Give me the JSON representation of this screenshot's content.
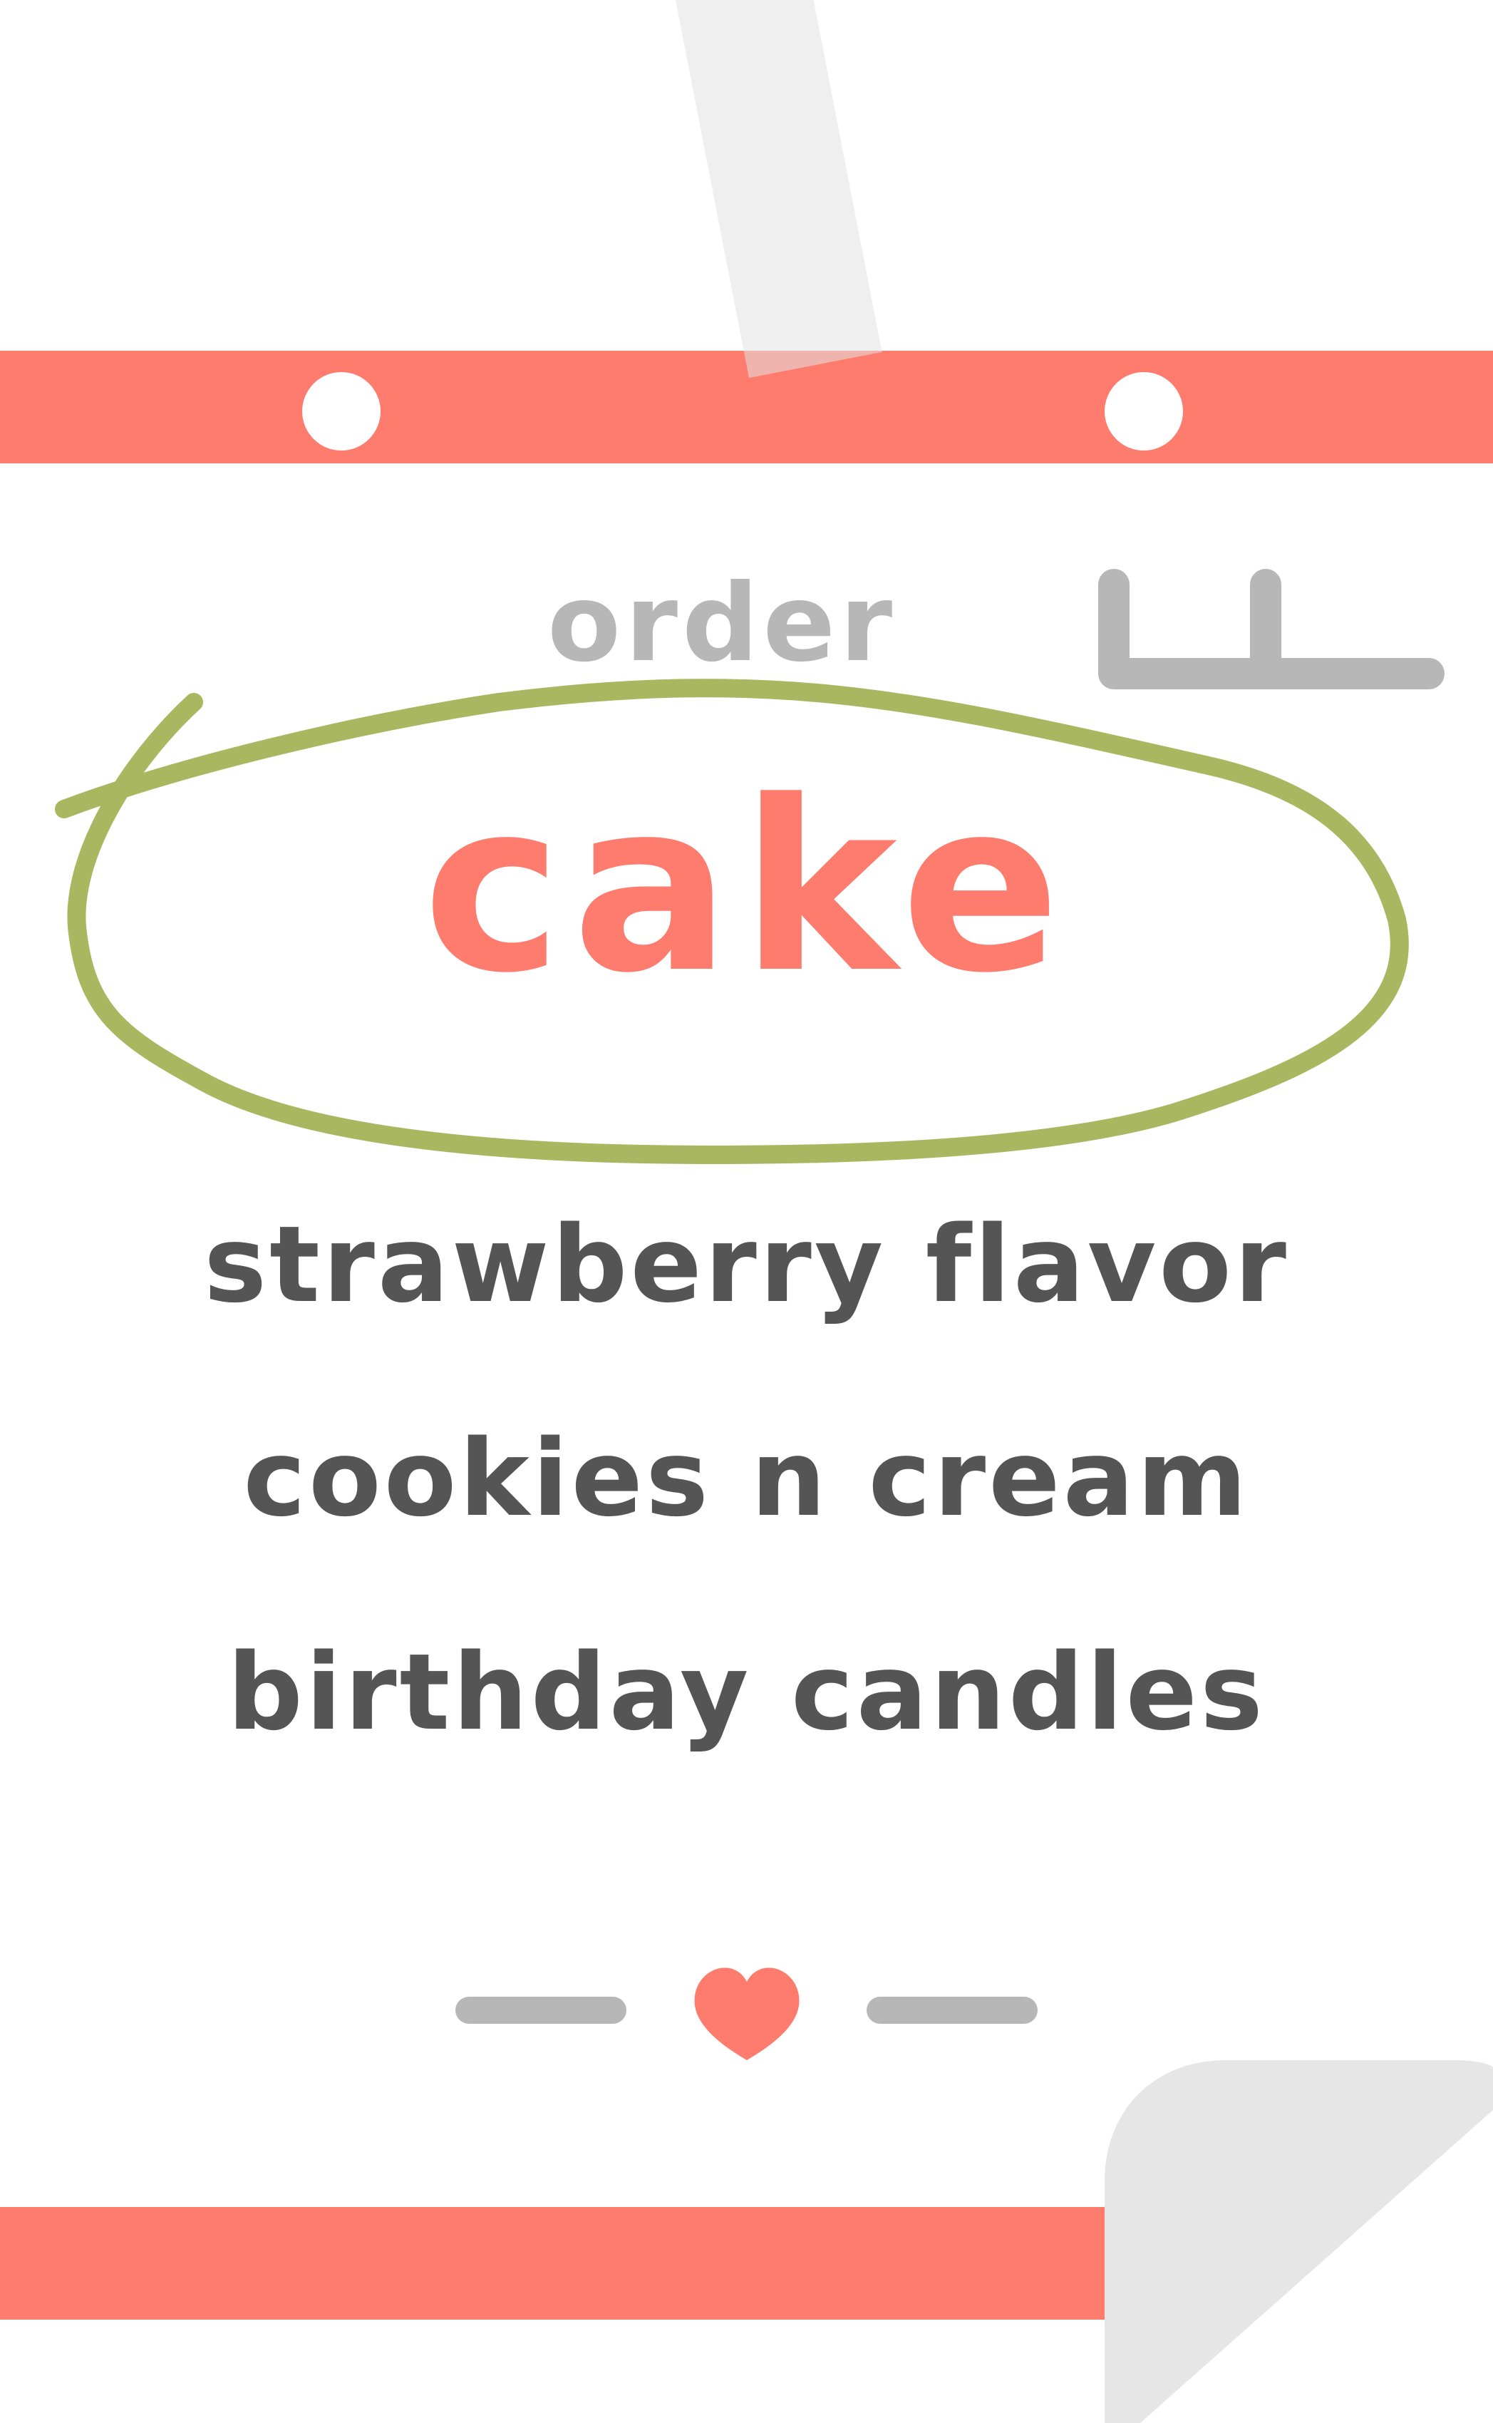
{
  "card": {
    "order_label": "order",
    "title": "cake",
    "flavors": [
      "strawberry flavor",
      "cookies n cream",
      "birthday candles"
    ]
  },
  "colors": {
    "accent": "#fe7c6e",
    "highlight_circle": "#a8b760",
    "muted_gray": "#b7b7b7",
    "text_dark": "#555555",
    "page_curl": "#e6e6e6"
  },
  "icons": {
    "tape": "tape-strip",
    "order_number_glyph": "order-number-glyph",
    "heart": "heart-icon",
    "page_curl": "page-curl"
  }
}
